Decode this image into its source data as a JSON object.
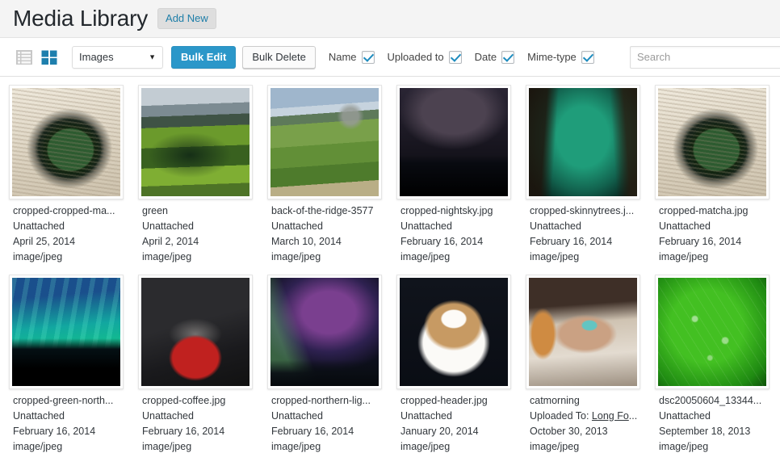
{
  "header": {
    "title": "Media Library",
    "add_new_label": "Add New"
  },
  "toolbar": {
    "list_view_icon": "list-view-icon",
    "grid_view_icon": "grid-view-icon",
    "active_view": "grid",
    "filter_value": "Images",
    "filter_options": [
      "Images"
    ],
    "bulk_edit_label": "Bulk Edit",
    "bulk_delete_label": "Bulk Delete",
    "checkboxes": [
      {
        "label": "Name",
        "checked": true
      },
      {
        "label": "Uploaded to",
        "checked": true
      },
      {
        "label": "Date",
        "checked": true
      },
      {
        "label": "Mime-type",
        "checked": true
      }
    ],
    "search": {
      "placeholder": "Search",
      "value": ""
    }
  },
  "colors": {
    "accent_blue": "#2b97c9",
    "checkbox_blue": "#1e8cbe",
    "link_blue": "#1e7ea8",
    "header_bg": "#f4f4f4",
    "text": "#32373c"
  },
  "media_items": [
    {
      "name": "cropped-cropped-ma...",
      "attachment": "Unattached",
      "date": "April 25, 2014",
      "mime": "image/jpeg",
      "thumb": "matcha-bowl-on-tatami"
    },
    {
      "name": "green",
      "attachment": "Unattached",
      "date": "April 2, 2014",
      "mime": "image/jpeg",
      "thumb": "green-mossy-valley"
    },
    {
      "name": "back-of-the-ridge-3577",
      "attachment": "Unattached",
      "date": "March 10, 2014",
      "mime": "image/jpeg",
      "thumb": "green-mountain-ridge-hikers"
    },
    {
      "name": "cropped-nightsky.jpg",
      "attachment": "Unattached",
      "date": "February 16, 2014",
      "mime": "image/jpeg",
      "thumb": "night-sky-over-treeline"
    },
    {
      "name": "cropped-skinnytrees.j...",
      "attachment": "Unattached",
      "date": "February 16, 2014",
      "mime": "image/jpeg",
      "thumb": "green-aurora-skinny-trees"
    },
    {
      "name": "cropped-matcha.jpg",
      "attachment": "Unattached",
      "date": "February 16, 2014",
      "mime": "image/jpeg",
      "thumb": "matcha-bowl-on-tatami"
    },
    {
      "name": "cropped-green-north...",
      "attachment": "Unattached",
      "date": "February 16, 2014",
      "mime": "image/jpeg",
      "thumb": "teal-aurora-over-forest"
    },
    {
      "name": "cropped-coffee.jpg",
      "attachment": "Unattached",
      "date": "February 16, 2014",
      "mime": "image/jpeg",
      "thumb": "red-mug-steaming-coffee"
    },
    {
      "name": "cropped-northern-lig...",
      "attachment": "Unattached",
      "date": "February 16, 2014",
      "mime": "image/jpeg",
      "thumb": "purple-green-northern-lights"
    },
    {
      "name": "cropped-header.jpg",
      "attachment": "Unattached",
      "date": "January 20, 2014",
      "mime": "image/jpeg",
      "thumb": "latte-art-heart-cup"
    },
    {
      "name": "catmorning",
      "attachment_prefix": "Uploaded To: ",
      "attachment_link": "Long Fo",
      "attachment_suffix": "...",
      "date": "October 30, 2013",
      "mime": "image/jpeg",
      "thumb": "woman-sleeping-with-cat"
    },
    {
      "name": "dsc20050604_13344...",
      "attachment": "Unattached",
      "date": "September 18, 2013",
      "mime": "image/jpeg",
      "thumb": "green-leaf-water-droplets"
    }
  ]
}
